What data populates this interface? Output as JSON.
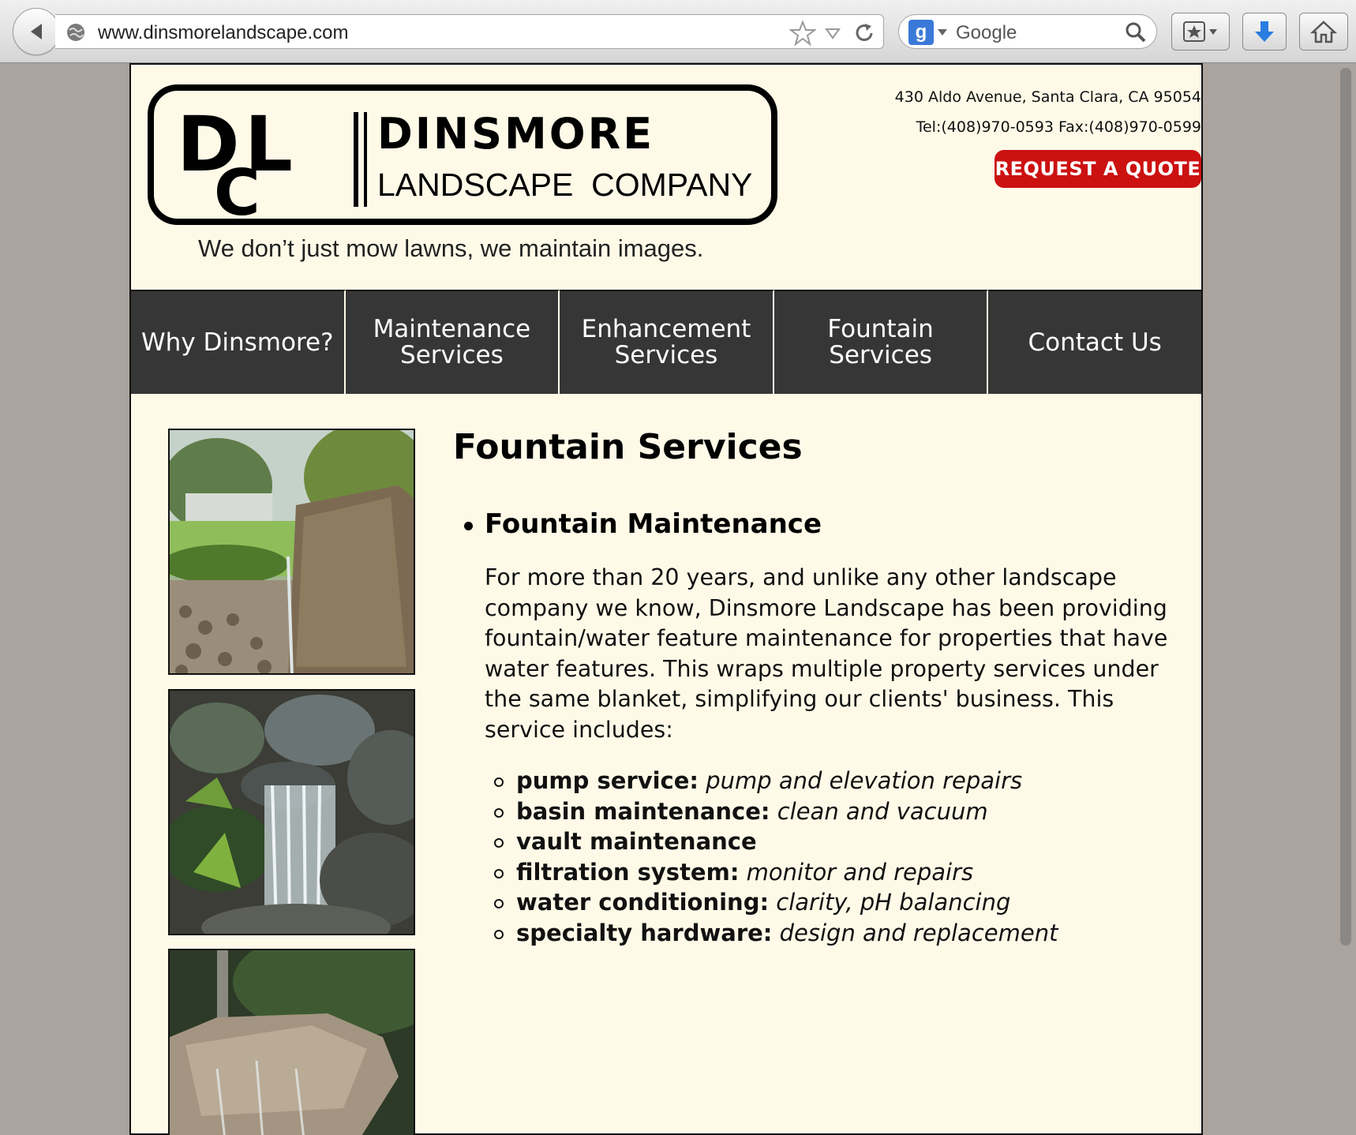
{
  "browser": {
    "url": "www.dinsmorelandscape.com",
    "search_placeholder": "Google",
    "search_engine_icon": "g"
  },
  "header": {
    "logo_initials": "DLC",
    "logo_name": "DINSMORE",
    "logo_sub": "LANDSCAPE  COMPANY",
    "tagline": "We don’t just mow lawns, we maintain images.",
    "address": "430 Aldo Avenue, Santa Clara, CA 95054",
    "phone_fax": "Tel:(408)970-0593 Fax:(408)970-0599",
    "quote_button": "REQUEST A QUOTE"
  },
  "nav": {
    "why": "Why Dinsmore?",
    "maintenance": "Maintenance Services",
    "enhancement": "Enhancement Services",
    "fountain": "Fountain Services",
    "contact": "Contact Us"
  },
  "main": {
    "title": "Fountain Services",
    "section_title": "Fountain Maintenance",
    "section_body": "For more than 20 years, and unlike any other landscape company we know, Dinsmore Landscape has been providing fountain/water feature maintenance for properties that have water features. This wraps multiple property services under the same blanket, simplifying our clients' business. This service includes:",
    "services": [
      {
        "name": "pump service:",
        "detail": "pump and elevation repairs"
      },
      {
        "name": "basin maintenance:",
        "detail": "clean and vacuum"
      },
      {
        "name": "vault maintenance",
        "detail": ""
      },
      {
        "name": "filtration system:",
        "detail": "monitor and repairs"
      },
      {
        "name": "water conditioning:",
        "detail": "clarity, pH balancing"
      },
      {
        "name": "specialty hardware:",
        "detail": "design and replacement"
      }
    ]
  },
  "colors": {
    "page_bg": "#fffae8",
    "nav_bg": "#363636",
    "quote_red": "#cc1111",
    "window_bg": "#aaa39e"
  }
}
